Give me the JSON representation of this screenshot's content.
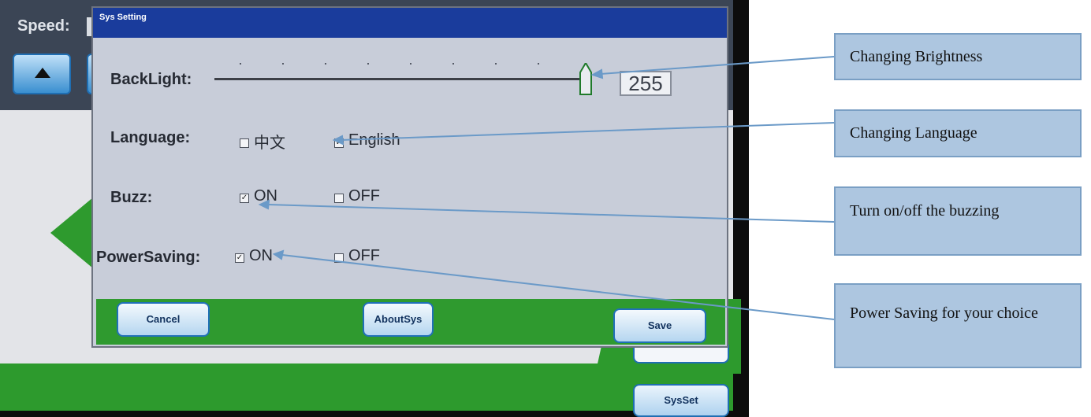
{
  "screen": {
    "speed_label": "Speed:",
    "sysset_button": "SysSet"
  },
  "dialog": {
    "title": "Sys Setting",
    "backlight": {
      "label": "BackLight:",
      "value": "255",
      "max": 255,
      "level": 1.0
    },
    "language": {
      "label": "Language:",
      "options": [
        {
          "text": "中文",
          "checked": false
        },
        {
          "text": "English",
          "checked": true
        }
      ]
    },
    "buzz": {
      "label": "Buzz:",
      "options": [
        {
          "text": "ON",
          "checked": true
        },
        {
          "text": "OFF",
          "checked": false
        }
      ]
    },
    "power_saving": {
      "label": "PowerSaving:",
      "options": [
        {
          "text": "ON",
          "checked": true
        },
        {
          "text": "OFF",
          "checked": false
        }
      ]
    },
    "buttons": {
      "cancel": "Cancel",
      "about": "AboutSys",
      "save": "Save"
    }
  },
  "callouts": [
    "Changing Brightness",
    "Changing Language",
    "Turn on/off the buzzing",
    "Power Saving for your choice"
  ],
  "colors": {
    "dialog_title_bar": "#1a3c9c",
    "callout_fill": "#adc6e0",
    "arrow": "#6b9ac8",
    "screen_green": "#2d9a2d"
  }
}
